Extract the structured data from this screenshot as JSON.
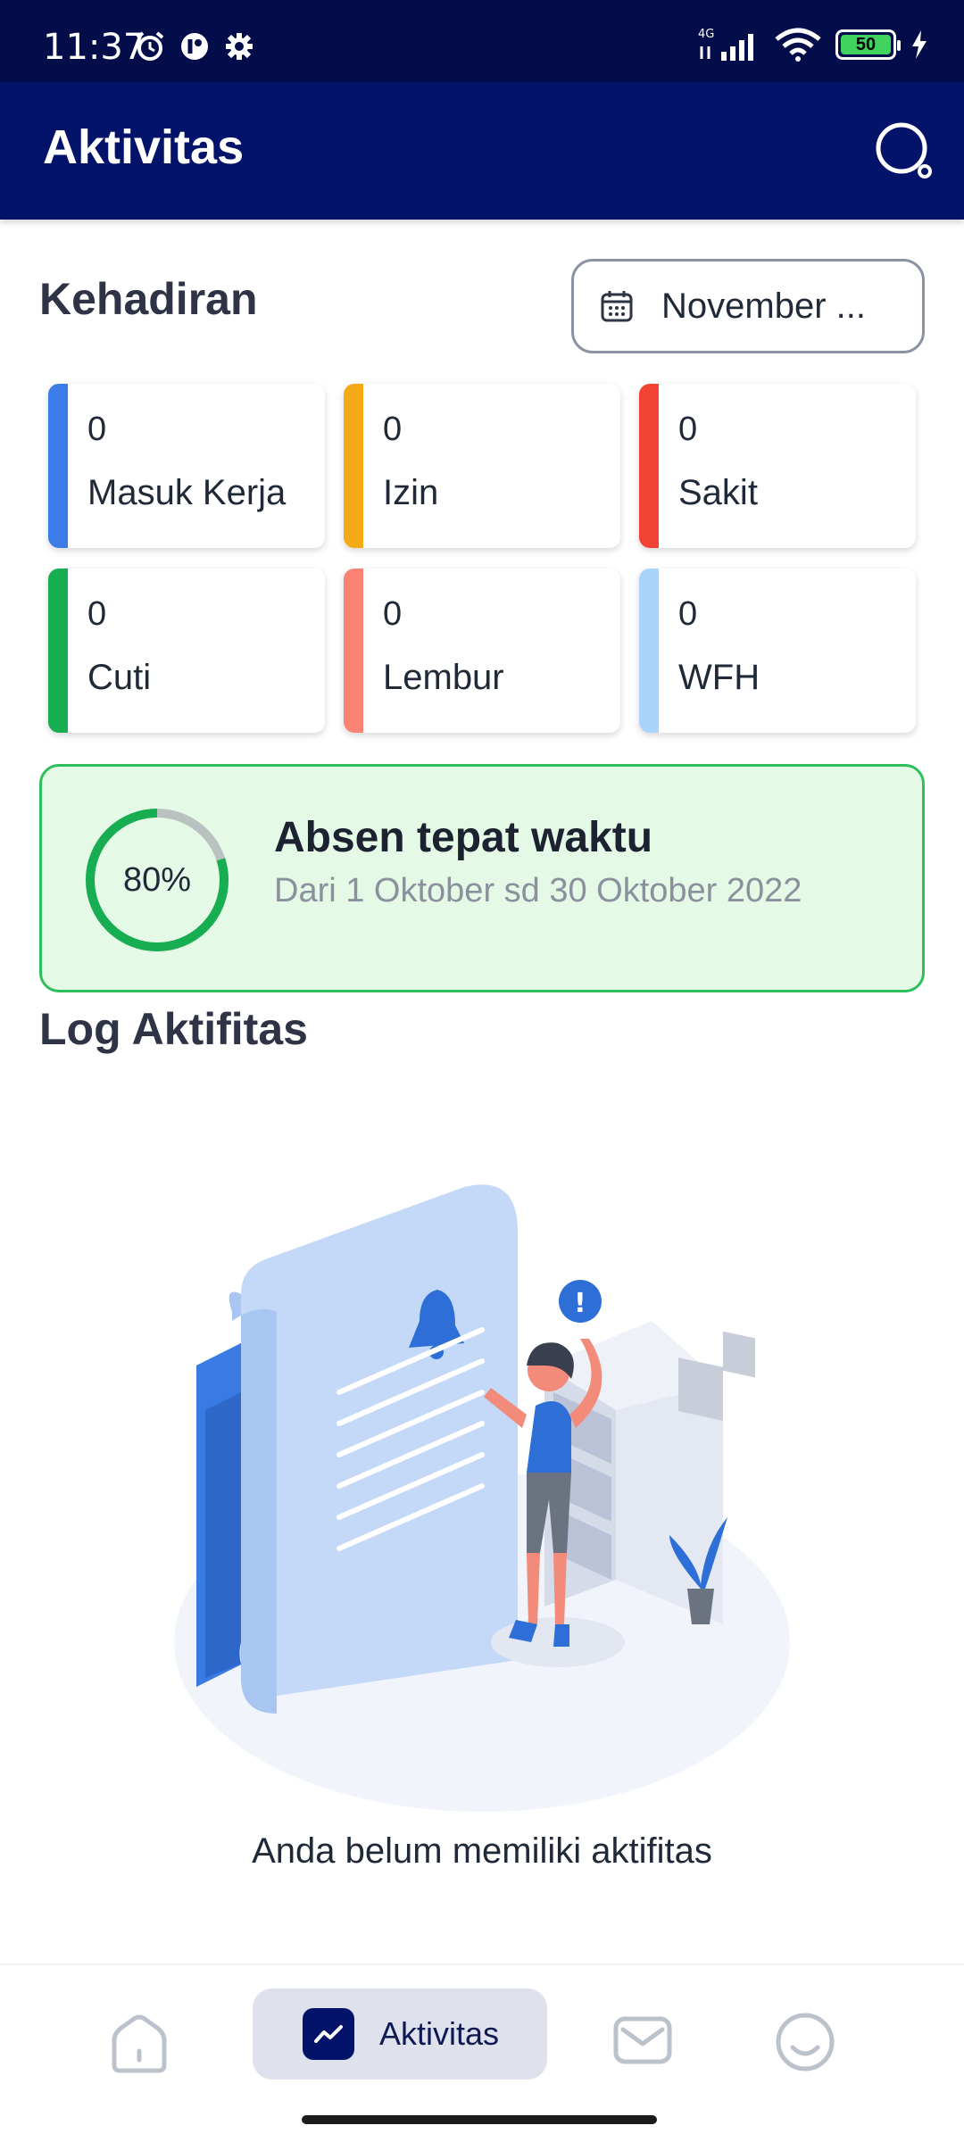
{
  "status_bar": {
    "time": "11:37",
    "network": "4G",
    "battery": "50",
    "icons_left": [
      "alarm-icon",
      "app-icon",
      "settings-icon"
    ],
    "icons_right": [
      "signal-icon",
      "wifi-icon",
      "battery-icon",
      "charging-icon"
    ]
  },
  "app_bar": {
    "title": "Aktivitas",
    "search_icon": "search-icon"
  },
  "attendance": {
    "title": "Kehadiran",
    "month_picker": {
      "icon": "calendar-icon",
      "label": "November ..."
    },
    "cards": [
      {
        "value": "0",
        "label": "Masuk Kerja",
        "color": "#3b7ce8"
      },
      {
        "value": "0",
        "label": "Izin",
        "color": "#f4a916"
      },
      {
        "value": "0",
        "label": "Sakit",
        "color": "#f24234"
      },
      {
        "value": "0",
        "label": "Cuti",
        "color": "#16ae51"
      },
      {
        "value": "0",
        "label": "Lembur",
        "color": "#fa8374"
      },
      {
        "value": "0",
        "label": "WFH",
        "color": "#a9d4fb"
      }
    ]
  },
  "on_time": {
    "percent_label": "80%",
    "percent": 0.8,
    "title": "Absen tepat waktu",
    "subtitle": "Dari 1 Oktober sd 30 Oktober 2022",
    "ring_color": "#16ae51",
    "track_color": "#b9c2c0"
  },
  "activity_log": {
    "title": "Log Aktifitas",
    "empty_text": "Anda belum memiliki aktifitas"
  },
  "bottom_nav": {
    "items": [
      {
        "icon": "home-icon",
        "label": ""
      },
      {
        "icon": "activity-icon",
        "label": "Aktivitas",
        "active": true
      },
      {
        "icon": "inbox-icon",
        "label": ""
      },
      {
        "icon": "profile-icon",
        "label": ""
      }
    ]
  },
  "colors": {
    "status_bar_bg": "#020d4a",
    "app_bar_bg": "#021369",
    "accent": "#021369"
  }
}
